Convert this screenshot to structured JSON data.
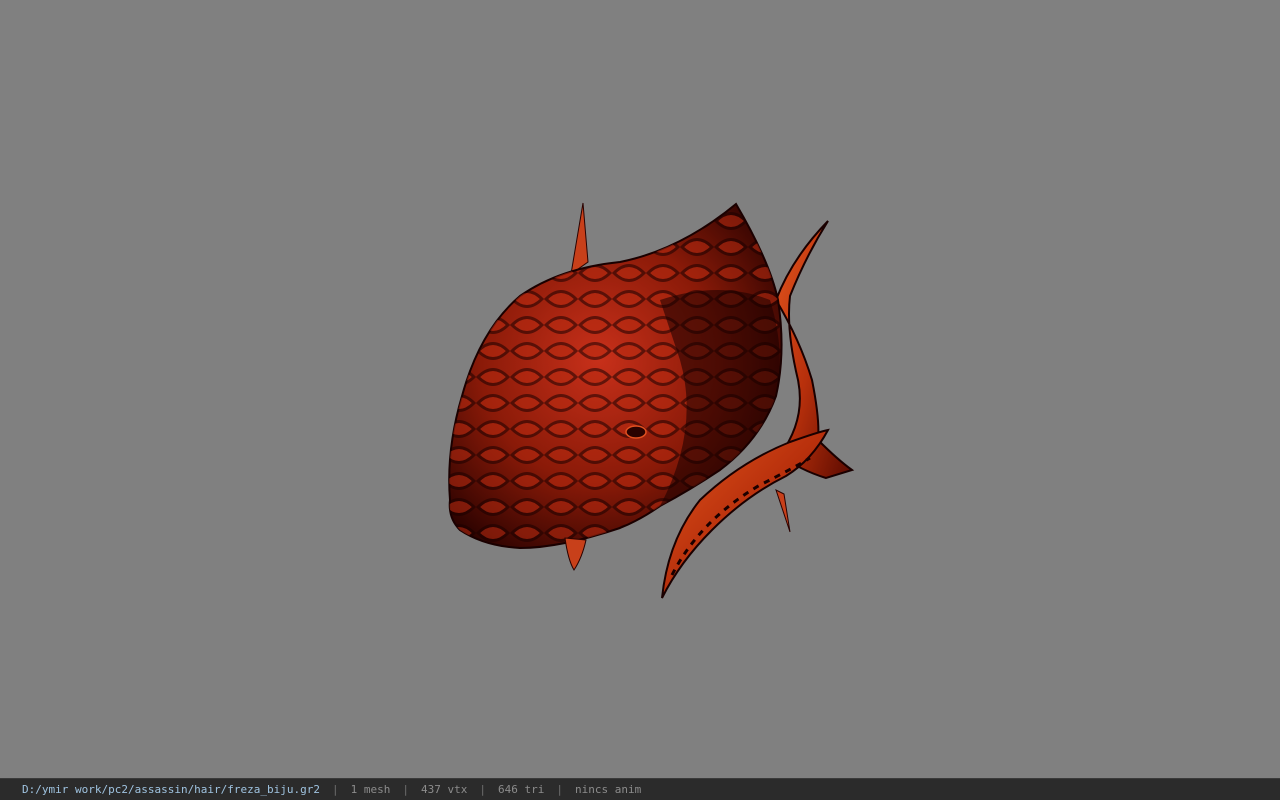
{
  "viewer": {
    "background_color": "#808080",
    "model": {
      "icon": "snake-head-model",
      "colors": {
        "scale_dark": "#4a0500",
        "scale_mid": "#a8200a",
        "scale_light": "#e0521c",
        "outline": "#1a0000"
      }
    }
  },
  "status": {
    "file_path": "D:/ymir work/pc2/assassin/hair/freza_biju.gr2",
    "separator": "|",
    "mesh_count": "1 mesh",
    "vertex_count": "437 vtx",
    "triangle_count": "646 tri",
    "anim": "nincs anim"
  }
}
